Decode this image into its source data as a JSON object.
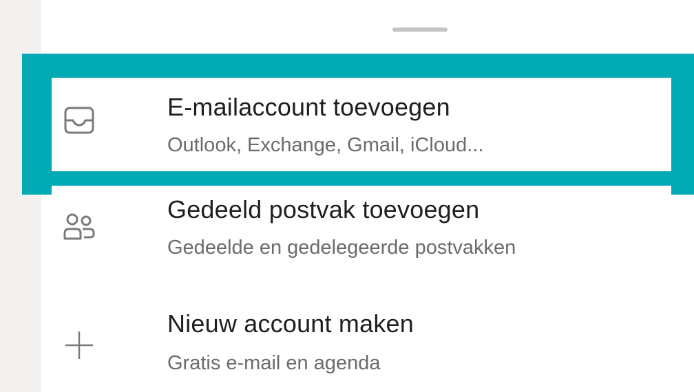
{
  "sheet": {
    "items": [
      {
        "title": "E-mailaccount toevoegen",
        "subtitle": "Outlook, Exchange, Gmail, iCloud...",
        "icon": "inbox-icon",
        "highlighted": true
      },
      {
        "title": "Gedeeld postvak toevoegen",
        "subtitle": "Gedeelde en gedelegeerde postvakken",
        "icon": "people-icon",
        "highlighted": false
      },
      {
        "title": "Nieuw account maken",
        "subtitle": "Gratis e-mail en agenda",
        "icon": "plus-icon",
        "highlighted": false
      }
    ]
  },
  "colors": {
    "highlight": "#00a9b3",
    "background": "#f2f1f0",
    "sheet": "#ffffff",
    "title_text": "#1f1f1f",
    "subtitle_text": "#6b6b6b"
  }
}
